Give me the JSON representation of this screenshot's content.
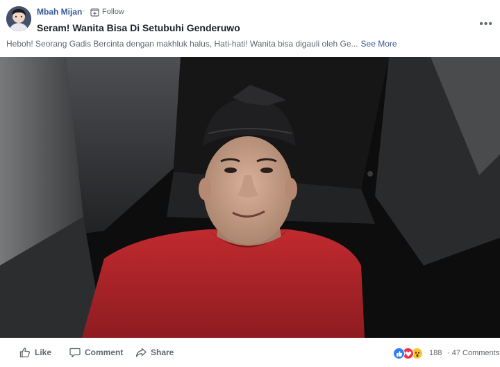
{
  "post": {
    "author": "Mbah Mijan",
    "separator": "·",
    "follow_label": "Follow",
    "title": "Seram! Wanita Bisa Di Setubuhi Genderuwo",
    "description": "Heboh! Seorang Gadis Bercinta dengan makhluk halus, Hati-hati! Wanita bisa digauli oleh Ge...",
    "see_more": "See More",
    "menu": "•••"
  },
  "actions": {
    "like": "Like",
    "comment": "Comment",
    "share": "Share"
  },
  "stats": {
    "reaction_count": "188",
    "separator": "·",
    "comments": "47 Comments"
  },
  "colors": {
    "link": "#385898",
    "shirt": "#b8262b",
    "like_reaction": "#2d7cf6",
    "love_reaction": "#f0304a",
    "wow_reaction": "#f7c533"
  },
  "icons": [
    "follow-icon",
    "like-icon",
    "comment-icon",
    "share-icon",
    "like-reaction-icon",
    "love-reaction-icon",
    "wow-reaction-icon"
  ]
}
